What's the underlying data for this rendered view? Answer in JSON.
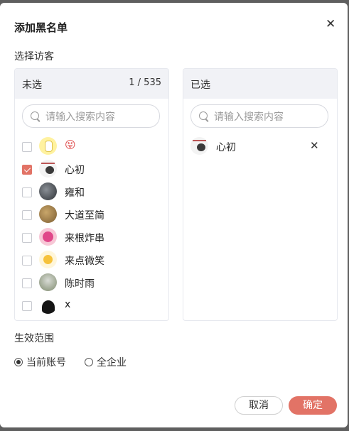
{
  "dialog": {
    "title": "添加黑名单",
    "close_glyph": "✕",
    "section_visitors": "选择访客",
    "section_scope": "生效范围"
  },
  "left_panel": {
    "title": "未选",
    "count": "1 / 535",
    "search_placeholder": "请输入搜索内容",
    "items": [
      {
        "name": "😝",
        "checked": false,
        "avatar": "sticker-avatar"
      },
      {
        "name": "心初",
        "checked": true,
        "avatar": "avatar"
      },
      {
        "name": "雍和",
        "checked": false,
        "avatar": "avatar"
      },
      {
        "name": "大道至简",
        "checked": false,
        "avatar": "avatar"
      },
      {
        "name": "来根炸串",
        "checked": false,
        "avatar": "avatar"
      },
      {
        "name": "来点微笑",
        "checked": false,
        "avatar": "avatar"
      },
      {
        "name": "陈时雨",
        "checked": false,
        "avatar": "avatar"
      },
      {
        "name": "x",
        "checked": false,
        "avatar": "avatar"
      }
    ]
  },
  "right_panel": {
    "title": "已选",
    "search_placeholder": "请输入搜索内容",
    "items": [
      {
        "name": "心初"
      }
    ],
    "remove_glyph": "✕"
  },
  "scope": {
    "options": [
      {
        "label": "当前账号",
        "selected": true
      },
      {
        "label": "全企业",
        "selected": false
      }
    ]
  },
  "footer": {
    "cancel_label": "取消",
    "ok_label": "确定"
  },
  "colors": {
    "accent": "#e27366",
    "panel_header": "#f1f2f6"
  }
}
